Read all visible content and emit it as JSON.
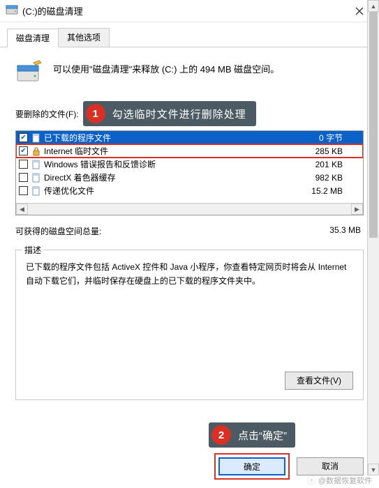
{
  "titlebar": {
    "title": "(C:)的磁盘清理"
  },
  "tabs": {
    "active": "磁盘清理",
    "inactive": "其他选项"
  },
  "intro": {
    "text": "可以使用\"磁盘清理\"来释放  (C:) 上的 494 MB 磁盘空间。"
  },
  "filesSectionLabel": "要删除的文件(F):",
  "callout1": {
    "num": "1",
    "text": "勾选临时文件进行删除处理"
  },
  "files": [
    {
      "checked": true,
      "icon": "page",
      "name": "已下载的程序文件",
      "size": "0 字节",
      "selected": true
    },
    {
      "checked": true,
      "icon": "lock",
      "name": "Internet 临时文件",
      "size": "285 KB",
      "highlight": true
    },
    {
      "checked": false,
      "icon": "page",
      "name": "Windows 错误报告和反馈诊断",
      "size": "201 KB"
    },
    {
      "checked": false,
      "icon": "page",
      "name": "DirectX 着色器缓存",
      "size": "982 KB"
    },
    {
      "checked": false,
      "icon": "page",
      "name": "传递优化文件",
      "size": "15.2 MB"
    }
  ],
  "total": {
    "label": "可获得的磁盘空间总量:",
    "value": "35.3 MB"
  },
  "descGroup": {
    "legend": "描述",
    "text": "已下载的程序文件包括 ActiveX 控件和 Java 小程序，你查看特定网页时将会从 Internet 自动下载它们，并临时保存在硬盘上的已下载的程序文件夹中。"
  },
  "buttons": {
    "viewFiles": "查看文件(V)",
    "ok": "确定",
    "cancel": "取消"
  },
  "callout2": {
    "num": "2",
    "text": "点击“确定”"
  },
  "watermark": "@数据恢复软件"
}
